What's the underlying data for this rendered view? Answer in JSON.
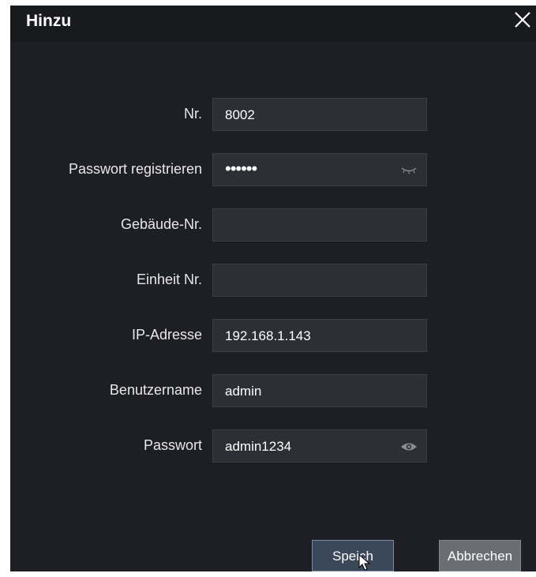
{
  "dialog": {
    "title": "Hinzu",
    "close_icon": "close-icon"
  },
  "fields": [
    {
      "label": "Nr.",
      "value": "8002",
      "icon": ""
    },
    {
      "label": "Passwort registrieren",
      "value": "••••••",
      "icon": "eye-closed-icon"
    },
    {
      "label": "Gebäude-Nr.",
      "value": "",
      "icon": ""
    },
    {
      "label": "Einheit Nr.",
      "value": "",
      "icon": ""
    },
    {
      "label": "IP-Adresse",
      "value": "192.168.1.143",
      "icon": ""
    },
    {
      "label": "Benutzername",
      "value": "admin",
      "icon": ""
    },
    {
      "label": "Passwort",
      "value": "admin1234",
      "icon": "eye-open-icon"
    }
  ],
  "buttons": {
    "save_label": "Speich",
    "cancel_label": "Abbrechen"
  },
  "colors": {
    "dialog_bg": "#1d1f24",
    "field_bg": "#2c2f35",
    "save_bg": "#3b4859",
    "cancel_bg": "#6a6d72"
  }
}
